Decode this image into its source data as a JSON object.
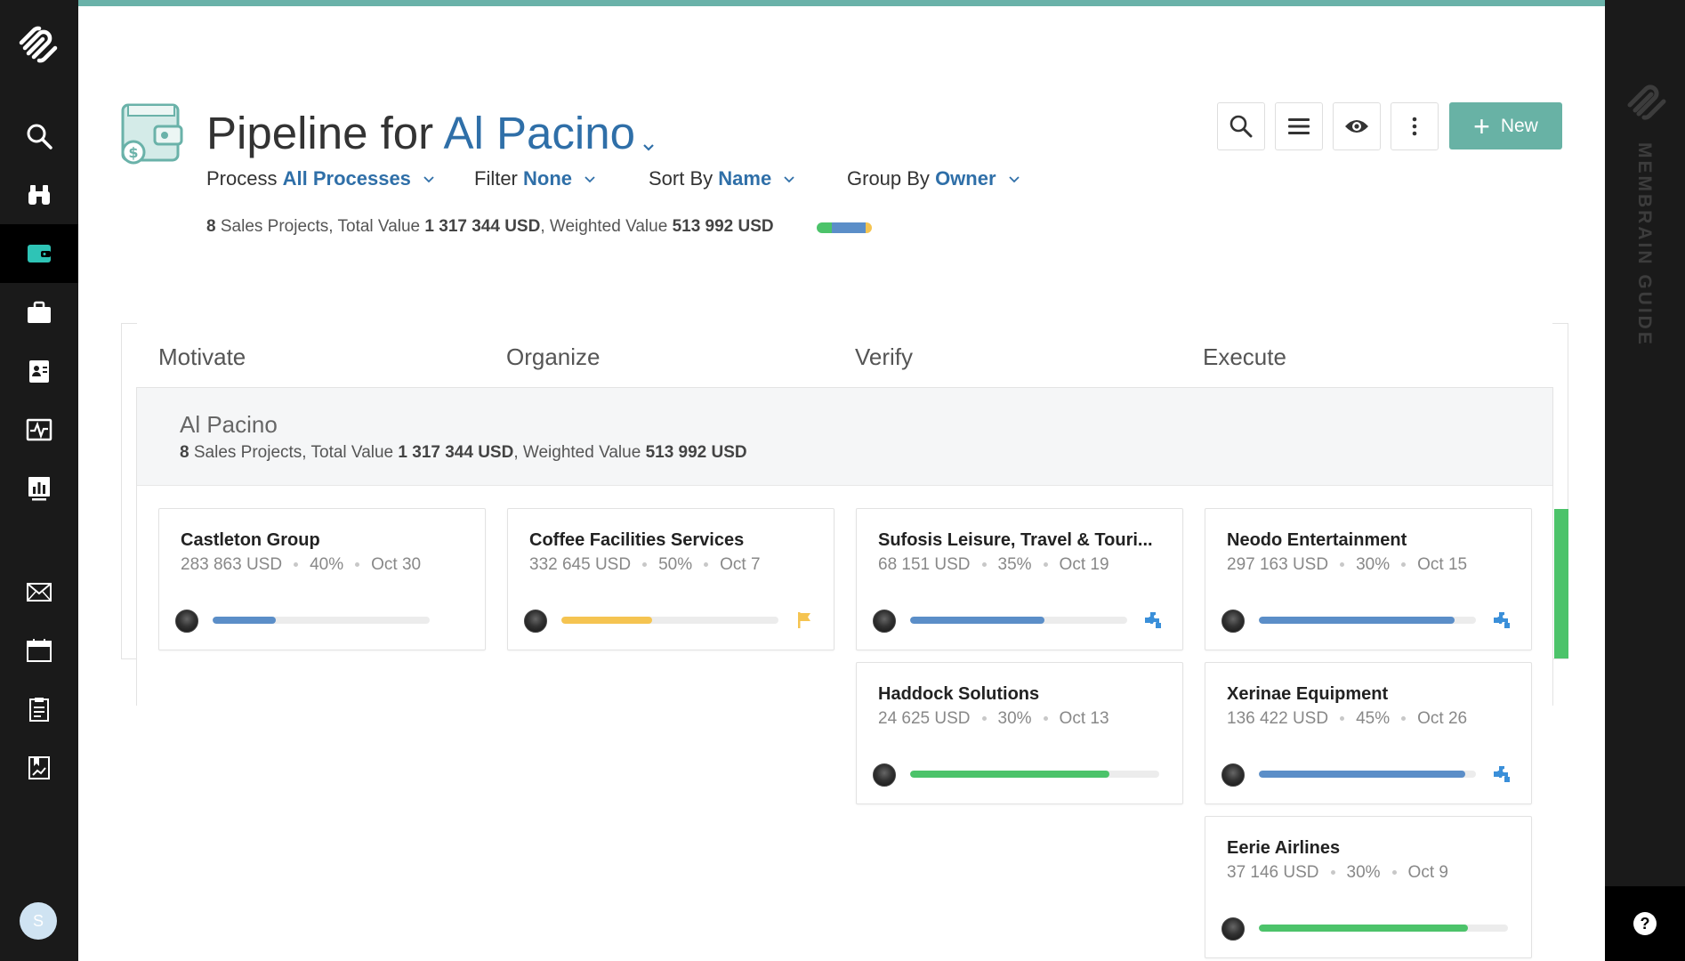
{
  "header": {
    "title_prefix": "Pipeline for",
    "owner": "Al Pacino",
    "filters": [
      {
        "label": "Process",
        "value": "All Processes"
      },
      {
        "label": "Filter",
        "value": "None"
      },
      {
        "label": "Sort By",
        "value": "Name"
      },
      {
        "label": "Group By",
        "value": "Owner"
      }
    ],
    "summary": {
      "count": "8",
      "count_label": "Sales Projects, Total Value",
      "total": "1 317 344 USD",
      "weighted_label": ", Weighted Value",
      "weighted": "513 992 USD",
      "bar": [
        {
          "color": "#4cc36a",
          "fraction": 0.28
        },
        {
          "color": "#5b8ec8",
          "fraction": 0.6
        },
        {
          "color": "#f5c451",
          "fraction": 0.12
        }
      ]
    },
    "new_button": "New"
  },
  "columns": [
    "Motivate",
    "Organize",
    "Verify",
    "Execute"
  ],
  "group": {
    "name": "Al Pacino",
    "count": "8",
    "count_label": "Sales Projects, Total Value",
    "total": "1 317 344 USD",
    "weighted_label": ", Weighted Value",
    "weighted": "513 992 USD"
  },
  "cards": [
    {
      "title": "Castleton Group",
      "value": "283 863 USD",
      "probability": "40%",
      "date": "Oct 30",
      "progress": 0.29,
      "bar_color": "#5b8ec8",
      "icon": "puzzle-icon"
    },
    {
      "title": "Coffee Facilities Services",
      "value": "332 645 USD",
      "probability": "50%",
      "date": "Oct 7",
      "progress": 0.42,
      "bar_color": "#f5c451",
      "icon": "flag-icon"
    },
    {
      "title": "Sufosis Leisure, Travel & Touri...",
      "value": "68 151 USD",
      "probability": "35%",
      "date": "Oct 19",
      "progress": 0.62,
      "bar_color": "#5b8ec8",
      "icon": "puzzle-icon"
    },
    {
      "title": "Neodo Entertainment",
      "value": "297 163 USD",
      "probability": "30%",
      "date": "Oct 15",
      "progress": 0.9,
      "bar_color": "#5b8ec8",
      "icon": "puzzle-icon"
    },
    {
      "title": "Haddock Solutions",
      "value": "24 625 USD",
      "probability": "30%",
      "date": "Oct 13",
      "progress": 0.8,
      "bar_color": "#4cc36a",
      "icon": ""
    },
    {
      "title": "Xerinae Equipment",
      "value": "136 422 USD",
      "probability": "45%",
      "date": "Oct 26",
      "progress": 0.95,
      "bar_color": "#5b8ec8",
      "icon": "puzzle-icon"
    },
    {
      "title": "Eerie Airlines",
      "value": "37 146 USD",
      "probability": "30%",
      "date": "Oct 9",
      "progress": 0.84,
      "bar_color": "#4cc36a",
      "icon": ""
    }
  ],
  "guide": {
    "label": "MEMBRAIN GUIDE"
  },
  "user": {
    "initial": "S"
  }
}
